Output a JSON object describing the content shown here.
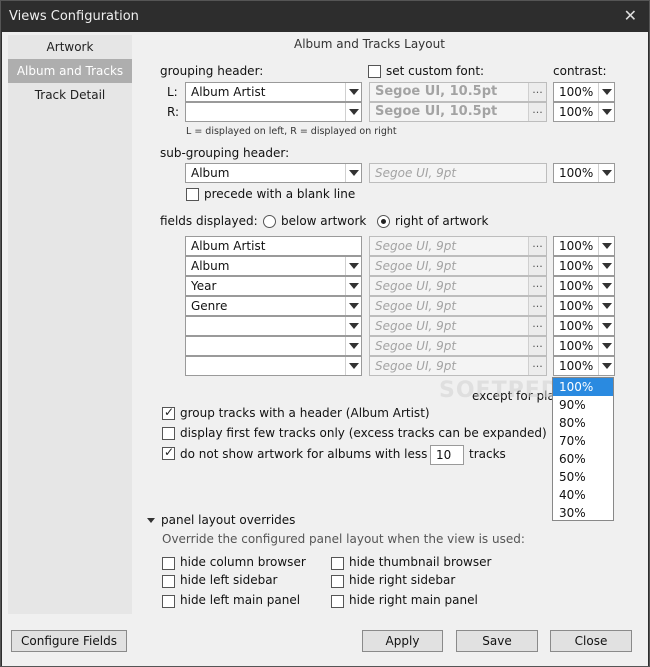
{
  "window": {
    "title": "Views Configuration"
  },
  "sidebar": {
    "items": [
      "Artwork",
      "Album and Tracks",
      "Track Detail"
    ]
  },
  "main": {
    "section_title": "Album and Tracks Layout",
    "grouping": {
      "header_label": "grouping header:",
      "custom_font_label": "set custom font:",
      "contrast_label": "contrast:",
      "left_prefix": "L:",
      "right_prefix": "R:",
      "left_value": "Album Artist",
      "right_value": "",
      "left_font": "Segoe UI, 10.5pt",
      "right_font": "Segoe UI, 10.5pt",
      "left_contrast": "100%",
      "right_contrast": "100%",
      "note": "L = displayed on left, R = displayed on right"
    },
    "subgrouping": {
      "label": "sub-grouping header:",
      "value": "Album",
      "font": "Segoe UI, 9pt",
      "contrast": "100%",
      "precede_label": "precede with a blank line"
    },
    "fields": {
      "label": "fields displayed:",
      "below_label": "below artwork",
      "right_label": "right of artwork",
      "rows": [
        {
          "value": "Album Artist",
          "font": "Segoe UI, 9pt",
          "contrast": "100%"
        },
        {
          "value": "Album",
          "font": "Segoe UI, 9pt",
          "contrast": "100%"
        },
        {
          "value": "Year",
          "font": "Segoe UI, 9pt",
          "contrast": "100%"
        },
        {
          "value": "Genre",
          "font": "Segoe UI, 9pt",
          "contrast": "100%"
        },
        {
          "value": "",
          "font": "Segoe UI, 9pt",
          "contrast": "100%"
        },
        {
          "value": "",
          "font": "Segoe UI, 9pt",
          "contrast": "100%"
        },
        {
          "value": "",
          "font": "Segoe UI, 9pt",
          "contrast": "100%"
        }
      ],
      "dots": "..."
    },
    "except_text": "except for playl",
    "options": {
      "group_tracks": "group tracks with a header (Album Artist)",
      "first_few": "display first few tracks only (excess tracks can be expanded)",
      "no_artwork": "do not show artwork for albums with less than",
      "no_artwork_count": "10",
      "tracks_suffix": "tracks"
    },
    "panel": {
      "title": "panel layout overrides",
      "description": "Override the configured panel layout when the view is used:",
      "opts": [
        "hide column browser",
        "hide thumbnail browser",
        "hide left sidebar",
        "hide right sidebar",
        "hide left main panel",
        "hide right main panel"
      ]
    },
    "dropdown": {
      "options": [
        "100%",
        "90%",
        "80%",
        "70%",
        "60%",
        "50%",
        "40%",
        "30%"
      ],
      "selected": "100%"
    },
    "watermark": "SOFTPEDIA"
  },
  "footer": {
    "configure": "Configure Fields",
    "apply": "Apply",
    "save": "Save",
    "close": "Close"
  }
}
